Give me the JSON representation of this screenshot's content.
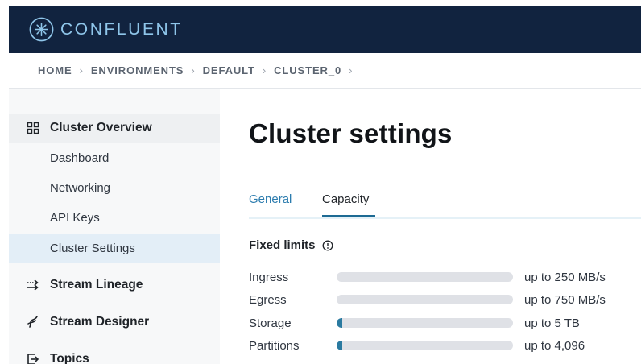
{
  "header": {
    "brand": "CONFLUENT",
    "logo_icon": "confluent-logo-icon"
  },
  "breadcrumb": [
    "HOME",
    "ENVIRONMENTS",
    "DEFAULT",
    "CLUSTER_0"
  ],
  "sidebar": {
    "sections": [
      {
        "label": "Cluster Overview",
        "icon": "grid-icon"
      },
      {
        "label": "Stream Lineage",
        "icon": "lineage-icon"
      },
      {
        "label": "Stream Designer",
        "icon": "designer-icon"
      },
      {
        "label": "Topics",
        "icon": "topics-icon"
      }
    ],
    "items": [
      {
        "label": "Dashboard"
      },
      {
        "label": "Networking"
      },
      {
        "label": "API Keys"
      },
      {
        "label": "Cluster Settings",
        "selected": true
      }
    ]
  },
  "main": {
    "title": "Cluster settings",
    "tabs": [
      {
        "label": "General"
      },
      {
        "label": "Capacity",
        "active": true
      }
    ],
    "section_title": "Fixed limits",
    "limits": [
      {
        "name": "Ingress",
        "value": "up to 250 MB/s",
        "usage": 0
      },
      {
        "name": "Egress",
        "value": "up to 750 MB/s",
        "usage": 0
      },
      {
        "name": "Storage",
        "value": "up to 5 TB",
        "usage": 0.03
      },
      {
        "name": "Partitions",
        "value": "up to 4,096",
        "usage": 0.03
      }
    ]
  },
  "colors": {
    "header_bg": "#11233f",
    "brand_text": "#8fc6ea",
    "accent": "#1d6a93",
    "selected_bg": "#e3eef7"
  }
}
